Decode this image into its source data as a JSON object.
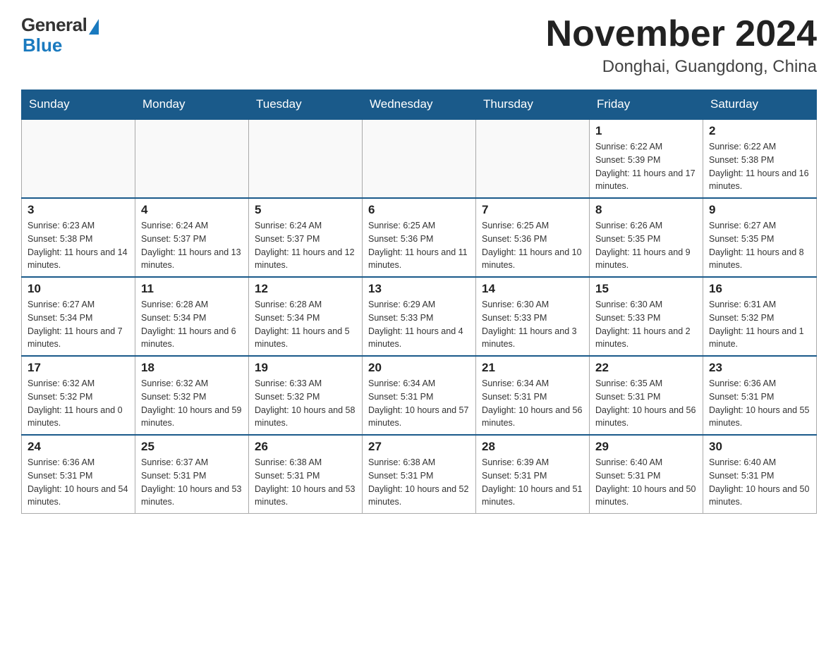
{
  "header": {
    "logo_general": "General",
    "logo_blue": "Blue",
    "month_title": "November 2024",
    "location": "Donghai, Guangdong, China"
  },
  "weekdays": [
    "Sunday",
    "Monday",
    "Tuesday",
    "Wednesday",
    "Thursday",
    "Friday",
    "Saturday"
  ],
  "weeks": [
    [
      {
        "day": "",
        "info": ""
      },
      {
        "day": "",
        "info": ""
      },
      {
        "day": "",
        "info": ""
      },
      {
        "day": "",
        "info": ""
      },
      {
        "day": "",
        "info": ""
      },
      {
        "day": "1",
        "info": "Sunrise: 6:22 AM\nSunset: 5:39 PM\nDaylight: 11 hours and 17 minutes."
      },
      {
        "day": "2",
        "info": "Sunrise: 6:22 AM\nSunset: 5:38 PM\nDaylight: 11 hours and 16 minutes."
      }
    ],
    [
      {
        "day": "3",
        "info": "Sunrise: 6:23 AM\nSunset: 5:38 PM\nDaylight: 11 hours and 14 minutes."
      },
      {
        "day": "4",
        "info": "Sunrise: 6:24 AM\nSunset: 5:37 PM\nDaylight: 11 hours and 13 minutes."
      },
      {
        "day": "5",
        "info": "Sunrise: 6:24 AM\nSunset: 5:37 PM\nDaylight: 11 hours and 12 minutes."
      },
      {
        "day": "6",
        "info": "Sunrise: 6:25 AM\nSunset: 5:36 PM\nDaylight: 11 hours and 11 minutes."
      },
      {
        "day": "7",
        "info": "Sunrise: 6:25 AM\nSunset: 5:36 PM\nDaylight: 11 hours and 10 minutes."
      },
      {
        "day": "8",
        "info": "Sunrise: 6:26 AM\nSunset: 5:35 PM\nDaylight: 11 hours and 9 minutes."
      },
      {
        "day": "9",
        "info": "Sunrise: 6:27 AM\nSunset: 5:35 PM\nDaylight: 11 hours and 8 minutes."
      }
    ],
    [
      {
        "day": "10",
        "info": "Sunrise: 6:27 AM\nSunset: 5:34 PM\nDaylight: 11 hours and 7 minutes."
      },
      {
        "day": "11",
        "info": "Sunrise: 6:28 AM\nSunset: 5:34 PM\nDaylight: 11 hours and 6 minutes."
      },
      {
        "day": "12",
        "info": "Sunrise: 6:28 AM\nSunset: 5:34 PM\nDaylight: 11 hours and 5 minutes."
      },
      {
        "day": "13",
        "info": "Sunrise: 6:29 AM\nSunset: 5:33 PM\nDaylight: 11 hours and 4 minutes."
      },
      {
        "day": "14",
        "info": "Sunrise: 6:30 AM\nSunset: 5:33 PM\nDaylight: 11 hours and 3 minutes."
      },
      {
        "day": "15",
        "info": "Sunrise: 6:30 AM\nSunset: 5:33 PM\nDaylight: 11 hours and 2 minutes."
      },
      {
        "day": "16",
        "info": "Sunrise: 6:31 AM\nSunset: 5:32 PM\nDaylight: 11 hours and 1 minute."
      }
    ],
    [
      {
        "day": "17",
        "info": "Sunrise: 6:32 AM\nSunset: 5:32 PM\nDaylight: 11 hours and 0 minutes."
      },
      {
        "day": "18",
        "info": "Sunrise: 6:32 AM\nSunset: 5:32 PM\nDaylight: 10 hours and 59 minutes."
      },
      {
        "day": "19",
        "info": "Sunrise: 6:33 AM\nSunset: 5:32 PM\nDaylight: 10 hours and 58 minutes."
      },
      {
        "day": "20",
        "info": "Sunrise: 6:34 AM\nSunset: 5:31 PM\nDaylight: 10 hours and 57 minutes."
      },
      {
        "day": "21",
        "info": "Sunrise: 6:34 AM\nSunset: 5:31 PM\nDaylight: 10 hours and 56 minutes."
      },
      {
        "day": "22",
        "info": "Sunrise: 6:35 AM\nSunset: 5:31 PM\nDaylight: 10 hours and 56 minutes."
      },
      {
        "day": "23",
        "info": "Sunrise: 6:36 AM\nSunset: 5:31 PM\nDaylight: 10 hours and 55 minutes."
      }
    ],
    [
      {
        "day": "24",
        "info": "Sunrise: 6:36 AM\nSunset: 5:31 PM\nDaylight: 10 hours and 54 minutes."
      },
      {
        "day": "25",
        "info": "Sunrise: 6:37 AM\nSunset: 5:31 PM\nDaylight: 10 hours and 53 minutes."
      },
      {
        "day": "26",
        "info": "Sunrise: 6:38 AM\nSunset: 5:31 PM\nDaylight: 10 hours and 53 minutes."
      },
      {
        "day": "27",
        "info": "Sunrise: 6:38 AM\nSunset: 5:31 PM\nDaylight: 10 hours and 52 minutes."
      },
      {
        "day": "28",
        "info": "Sunrise: 6:39 AM\nSunset: 5:31 PM\nDaylight: 10 hours and 51 minutes."
      },
      {
        "day": "29",
        "info": "Sunrise: 6:40 AM\nSunset: 5:31 PM\nDaylight: 10 hours and 50 minutes."
      },
      {
        "day": "30",
        "info": "Sunrise: 6:40 AM\nSunset: 5:31 PM\nDaylight: 10 hours and 50 minutes."
      }
    ]
  ]
}
